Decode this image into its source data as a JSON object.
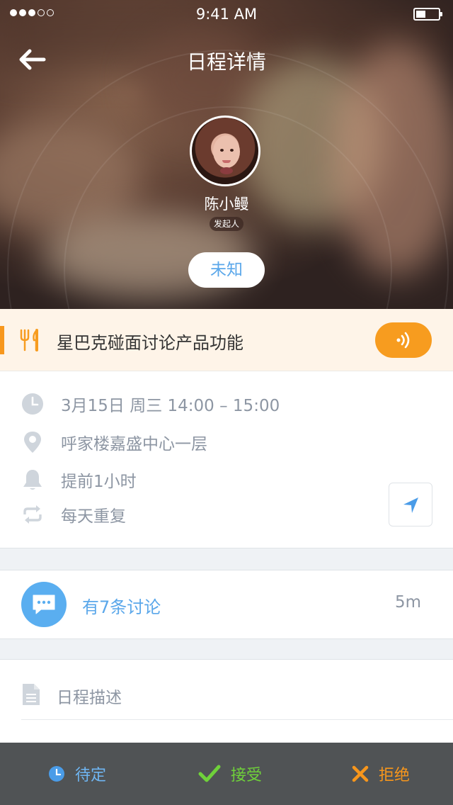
{
  "status_bar": {
    "time": "9:41 AM",
    "signal_bars": 3,
    "signal_total": 5
  },
  "header": {
    "title": "日程详情"
  },
  "organizer": {
    "name": "陈小鳗",
    "role_badge": "发起人",
    "attendance_status": "未知"
  },
  "event": {
    "title": "星巴克碰面讨论产品功能",
    "accent_color": "#f7971d"
  },
  "details": {
    "datetime": "3月15日 周三 14:00 – 15:00",
    "location": "呼家楼嘉盛中心一层",
    "reminder": "提前1小时",
    "repeat": "每天重复"
  },
  "discussion": {
    "label": "有7条讨论",
    "time": "5m"
  },
  "description": {
    "title": "日程描述",
    "body": ""
  },
  "actions": {
    "pending": "待定",
    "accept": "接受",
    "reject": "拒绝"
  },
  "icons": {
    "back": "arrow-left-icon",
    "restaurant": "fork-knife-icon",
    "voice": "sound-wave-icon",
    "clock": "clock-icon",
    "location": "location-pin-icon",
    "bell": "bell-icon",
    "repeat": "repeat-icon",
    "navigate": "navigation-arrow-icon",
    "chat": "chat-bubble-icon",
    "document": "document-icon"
  },
  "colors": {
    "brand_blue": "#5aa7ea",
    "orange": "#f79c1f",
    "green": "#6fd13a"
  }
}
